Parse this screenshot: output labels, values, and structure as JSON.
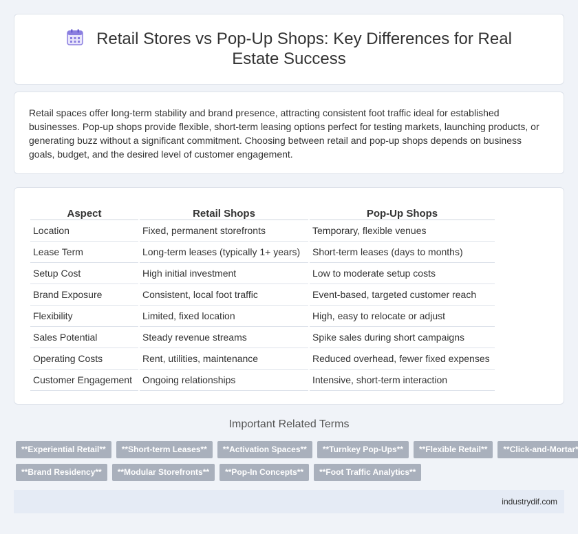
{
  "title": "Retail Stores vs Pop-Up Shops: Key Differences for Real Estate Success",
  "title_icon": "calendar-icon",
  "intro": "Retail spaces offer long-term stability and brand presence, attracting consistent foot traffic ideal for established businesses. Pop-up shops provide flexible, short-term leasing options perfect for testing markets, launching products, or generating buzz without a significant commitment. Choosing between retail and pop-up shops depends on business goals, budget, and the desired level of customer engagement.",
  "table": {
    "headers": [
      "Aspect",
      "Retail Shops",
      "Pop-Up Shops"
    ],
    "rows": [
      [
        "Location",
        "Fixed, permanent storefronts",
        "Temporary, flexible venues"
      ],
      [
        "Lease Term",
        "Long-term leases (typically 1+ years)",
        "Short-term leases (days to months)"
      ],
      [
        "Setup Cost",
        "High initial investment",
        "Low to moderate setup costs"
      ],
      [
        "Brand Exposure",
        "Consistent, local foot traffic",
        "Event-based, targeted customer reach"
      ],
      [
        "Flexibility",
        "Limited, fixed location",
        "High, easy to relocate or adjust"
      ],
      [
        "Sales Potential",
        "Steady revenue streams",
        "Spike sales during short campaigns"
      ],
      [
        "Operating Costs",
        "Rent, utilities, maintenance",
        "Reduced overhead, fewer fixed expenses"
      ],
      [
        "Customer Engagement",
        "Ongoing relationships",
        "Intensive, short-term interaction"
      ]
    ]
  },
  "related": {
    "title": "Important Related Terms",
    "rows": [
      [
        "**Experiential Retail**",
        "**Short-term Leases**",
        "**Activation Spaces**",
        "**Turnkey Pop-Ups**",
        "**Flexible Retail**",
        "**Click-and-Mortar**"
      ],
      [
        "**Brand Residency**",
        "**Modular Storefronts**",
        "**Pop-In Concepts**",
        "**Foot Traffic Analytics**"
      ]
    ]
  },
  "footer": "industrydif.com",
  "colors": {
    "background": "#f0f3f8",
    "tag_bg": "#a9b0bc",
    "footer_bg": "#e5ebf5",
    "icon_accent": "#8b7fe0"
  }
}
